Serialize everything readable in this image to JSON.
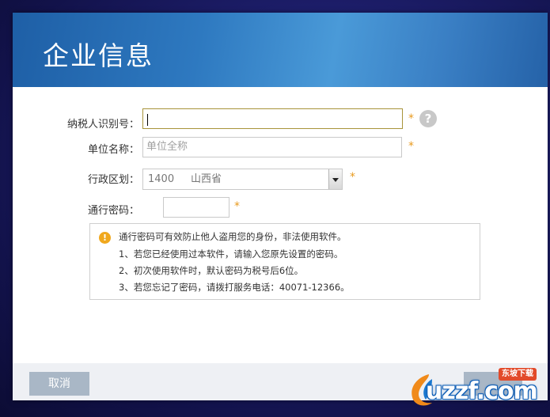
{
  "dialog": {
    "title": "企业信息",
    "fields": {
      "taxpayer_id": {
        "label": "纳税人识别号：",
        "value": "",
        "required_mark": "*",
        "help_icon": "?"
      },
      "unit_name": {
        "label": "单位名称：",
        "placeholder": "单位全称",
        "required_mark": "*"
      },
      "region": {
        "label": "行政区划：",
        "code": "1400",
        "name": "山西省",
        "required_mark": "*"
      },
      "pass_code": {
        "label": "通行密码：",
        "value": "",
        "required_mark": "*"
      }
    },
    "info": {
      "icon": "!",
      "lines": [
        "通行密码可有效防止他人盗用您的身份，非法使用软件。",
        "1、若您已经使用过本软件，请输入您原先设置的密码。",
        "2、初次使用软件时，默认密码为税号后6位。",
        "3、若您忘记了密码，请拨打服务电话：40071-12366。"
      ]
    },
    "footer": {
      "cancel_label": "取消"
    }
  },
  "watermark": {
    "text": "uzzf.com",
    "badge": "东坡下载"
  },
  "colors": {
    "header_start": "#1e5fa6",
    "header_mid": "#4a9ad8",
    "required": "#e89a1e",
    "button_bg": "#a9b7c6",
    "info_icon": "#f0a81e"
  }
}
